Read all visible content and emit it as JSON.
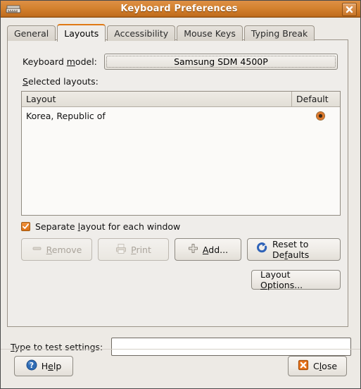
{
  "window": {
    "title": "Keyboard Preferences",
    "icon": "keyboard-icon",
    "close_label": "×"
  },
  "tabs": [
    {
      "label": "General",
      "active": false
    },
    {
      "label": "Layouts",
      "active": true
    },
    {
      "label": "Accessibility",
      "active": false
    },
    {
      "label": "Mouse Keys",
      "active": false
    },
    {
      "label": "Typing Break",
      "active": false
    }
  ],
  "layouts_tab": {
    "model_label_pre": "Keyboard ",
    "model_label_mnemonic": "m",
    "model_label_post": "odel:",
    "model_value": "Samsung SDM 4500P",
    "selected_layouts_mnemonic": "S",
    "selected_layouts_post": "elected layouts:",
    "table": {
      "columns": [
        "Layout",
        "Default"
      ],
      "rows": [
        {
          "layout": "Korea, Republic of",
          "default": true
        }
      ]
    },
    "separate_layout": {
      "checked": true,
      "label_pre": "Separate ",
      "label_mnemonic": "l",
      "label_post": "ayout for each window"
    },
    "buttons": {
      "remove": {
        "pre": "",
        "mnemonic": "R",
        "post": "emove",
        "enabled": false,
        "icon": "minus-icon"
      },
      "print": {
        "pre": "",
        "mnemonic": "P",
        "post": "rint",
        "enabled": false,
        "icon": "printer-icon"
      },
      "add": {
        "pre": "",
        "mnemonic": "A",
        "post": "dd...",
        "enabled": true,
        "icon": "plus-icon"
      },
      "reset": {
        "pre": "Reset to De",
        "mnemonic": "f",
        "post": "aults",
        "enabled": true,
        "icon": "refresh-icon"
      },
      "layout_options": {
        "pre": "Layout ",
        "mnemonic": "O",
        "post": "ptions...",
        "enabled": true
      }
    }
  },
  "test_settings": {
    "label_mnemonic": "T",
    "label_post": "ype to test settings:",
    "value": "",
    "placeholder": ""
  },
  "footer": {
    "help": {
      "pre": "H",
      "mnemonic": "e",
      "post": "lp",
      "icon": "help-icon"
    },
    "close": {
      "pre": "C",
      "mnemonic": "l",
      "post": "ose",
      "icon": "close-x-icon"
    }
  },
  "colors": {
    "titlebar_top": "#dd9046",
    "titlebar_bottom": "#c06c1d",
    "accent_orange": "#e07a16",
    "window_bg": "#edeae5",
    "list_bg": "#fbfaf8",
    "help_blue": "#2f6cb5",
    "close_orange": "#e8721a"
  }
}
